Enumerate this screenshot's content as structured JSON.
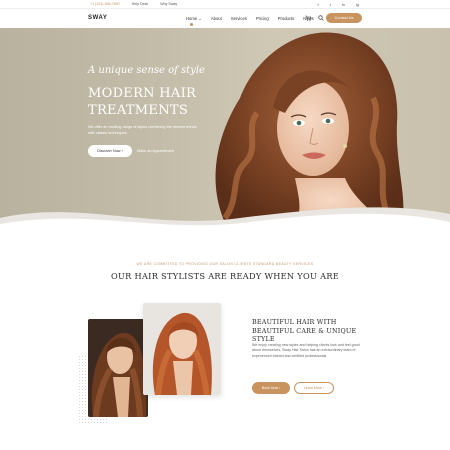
{
  "topbar": {
    "phone": "+1 (123) 456-7890",
    "link_help": "Help Desk",
    "link_about": "Why Sway",
    "social": [
      "f",
      "t",
      "in",
      "ig"
    ]
  },
  "header": {
    "logo": "SWAY",
    "nav": [
      "Home",
      "About",
      "Services",
      "Pricing",
      "Products",
      "News"
    ],
    "nav_caret": "⌄",
    "cart_icon": "cart-icon",
    "search_icon": "search-icon",
    "contact_button": "Contact Us"
  },
  "hero": {
    "tagline": "A unique sense of style",
    "title": "MODERN HAIR TREATMENTS",
    "subtitle": "We offer an exciting range of styles combining the newest trends with classic techniques.",
    "discover_button": "Discover Now",
    "appointment_link": "Make an Appointment",
    "arrow": "›"
  },
  "stylists": {
    "kicker": "WE ARE COMMITTED TO PROVIDING OUR SALON CLIENTS STANDARD BEAUTY SERVICES",
    "title": "OUR HAIR STYLISTS ARE READY WHEN YOU ARE",
    "block_title": "BEAUTIFUL HAIR WITH BEAUTIFUL CARE & UNIQUE STYLE",
    "block_text": "We enjoy creating new styles and helping clients look and feel good about themselves. Sway Hair Salon has an extraordinary team of experienced trained and certified professionals.",
    "book_button": "Book Now",
    "learn_button": "Learn More",
    "arrow": "›"
  },
  "colors": {
    "accent": "#c8935f",
    "hero_bg": "#c3bca9",
    "heading": "#2b2b2b"
  }
}
